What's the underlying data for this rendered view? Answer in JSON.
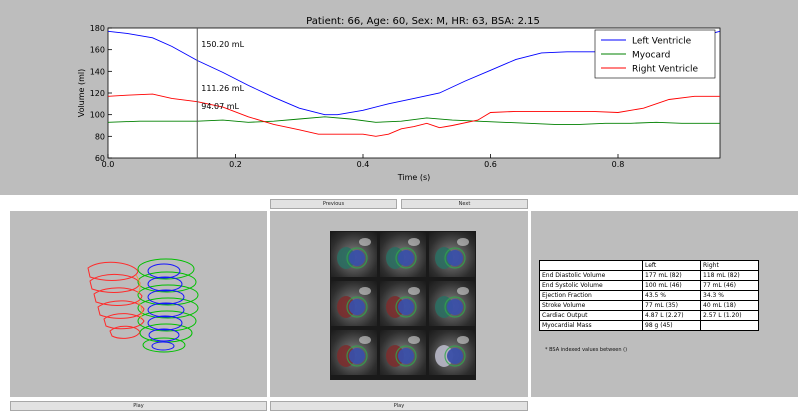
{
  "chart": {
    "title": "Patient: 66, Age: 60, Sex: M, HR: 63, BSA: 2.15",
    "marker_time": 0.14,
    "annotations": [
      "150.20 mL",
      "111.26 mL",
      "94.07 mL"
    ],
    "colors": {
      "Left Ventricle": "#0000ff",
      "Myocard": "#008000",
      "Right Ventricle": "#ff0000"
    }
  },
  "chart_data": {
    "type": "line",
    "title": "Patient: 66, Age: 60, Sex: M, HR: 63, BSA: 2.15",
    "xlabel": "Time (s)",
    "ylabel": "Volume (ml)",
    "xlim": [
      0.0,
      0.96
    ],
    "ylim": [
      60,
      180
    ],
    "xticks": [
      0.0,
      0.2,
      0.4,
      0.6,
      0.8
    ],
    "yticks": [
      60,
      80,
      100,
      120,
      140,
      160,
      180
    ],
    "legend_position": "top-right",
    "grid": false,
    "series": [
      {
        "name": "Left Ventricle",
        "x": [
          0.0,
          0.03,
          0.07,
          0.1,
          0.14,
          0.18,
          0.22,
          0.26,
          0.3,
          0.34,
          0.36,
          0.4,
          0.44,
          0.48,
          0.52,
          0.56,
          0.6,
          0.64,
          0.68,
          0.72,
          0.76,
          0.8,
          0.84,
          0.88,
          0.92,
          0.96
        ],
        "y": [
          177,
          175,
          171,
          163,
          150,
          139,
          127,
          116,
          106,
          100,
          100,
          104,
          110,
          115,
          120,
          131,
          141,
          151,
          157,
          158,
          158,
          158,
          160,
          164,
          171,
          177
        ]
      },
      {
        "name": "Myocard",
        "x": [
          0.0,
          0.05,
          0.1,
          0.14,
          0.18,
          0.22,
          0.26,
          0.3,
          0.34,
          0.38,
          0.42,
          0.46,
          0.5,
          0.54,
          0.58,
          0.62,
          0.66,
          0.7,
          0.74,
          0.78,
          0.82,
          0.86,
          0.9,
          0.96
        ],
        "y": [
          93,
          94,
          94,
          94,
          95,
          93,
          94,
          96,
          98,
          96,
          93,
          94,
          97,
          95,
          94,
          93,
          92,
          91,
          91,
          92,
          92,
          93,
          92,
          92
        ]
      },
      {
        "name": "Right Ventricle",
        "x": [
          0.0,
          0.03,
          0.07,
          0.1,
          0.14,
          0.18,
          0.22,
          0.26,
          0.3,
          0.33,
          0.36,
          0.4,
          0.42,
          0.44,
          0.46,
          0.48,
          0.5,
          0.52,
          0.54,
          0.58,
          0.6,
          0.64,
          0.68,
          0.72,
          0.76,
          0.8,
          0.84,
          0.88,
          0.92,
          0.96
        ],
        "y": [
          117,
          118,
          119,
          115,
          112,
          107,
          98,
          91,
          86,
          82,
          82,
          82,
          80,
          82,
          87,
          89,
          92,
          88,
          90,
          95,
          102,
          103,
          103,
          103,
          103,
          102,
          106,
          114,
          117,
          117
        ]
      }
    ]
  },
  "controls": {
    "previous": "Previous",
    "next": "Next",
    "play_left": "Play",
    "play_middle": "Play"
  },
  "metrics_table": {
    "headers": [
      "",
      "Left",
      "Right"
    ],
    "rows": [
      [
        "End Diastolic Volume",
        "177 mL (82)",
        "118 mL (82)"
      ],
      [
        "End Systolic Volume",
        "100 mL (46)",
        "77 mL (46)"
      ],
      [
        "Ejection Fraction",
        "43.5 %",
        "34.3 %"
      ],
      [
        "Stroke Volume",
        "77 mL (35)",
        "40 mL (18)"
      ],
      [
        "Cardiac Output",
        "4.87 L (2.27)",
        "2.57 L (1.20)"
      ],
      [
        "Myocardial Mass",
        "98 g (45)",
        ""
      ]
    ],
    "note": "* BSA indexed values between ()"
  }
}
